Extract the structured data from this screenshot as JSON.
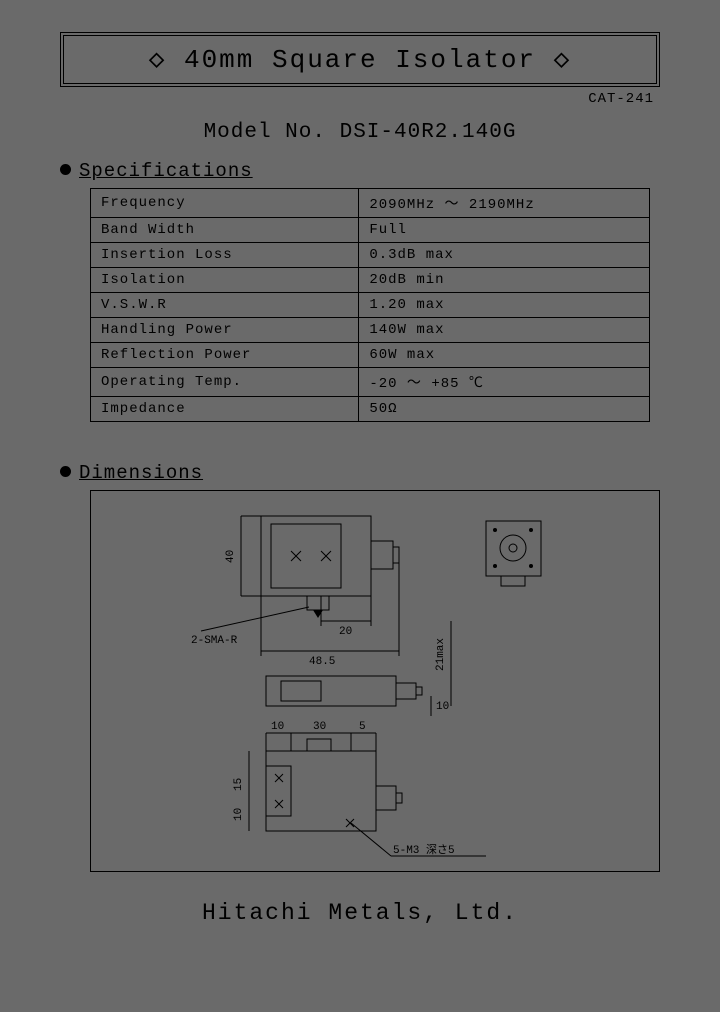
{
  "title": "◇ 40mm Square Isolator ◇",
  "cat": "CAT-241",
  "model_label": "Model No.",
  "model_value": "DSI-40R2.140G",
  "section_spec": "Specifications",
  "section_dim": "Dimensions",
  "spec_rows": [
    {
      "k": "Frequency",
      "v": "2090MHz ～ 2190MHz"
    },
    {
      "k": "Band Width",
      "v": "Full"
    },
    {
      "k": "Insertion Loss",
      "v": "0.3dB max"
    },
    {
      "k": "Isolation",
      "v": "20dB min"
    },
    {
      "k": "V.S.W.R",
      "v": "1.20 max"
    },
    {
      "k": "Handling Power",
      "v": "140W max"
    },
    {
      "k": "Reflection Power",
      "v": "60W max"
    },
    {
      "k": "Operating Temp.",
      "v": "-20 ～ +85 ℃"
    },
    {
      "k": "Impedance",
      "v": "50Ω"
    }
  ],
  "dim_labels": {
    "connector": "2-SMA-R",
    "d40": "40",
    "d20": "20",
    "d485": "48.5",
    "d21max": "21max",
    "d10a": "10",
    "d10b": "10",
    "d30": "30",
    "d5": "5",
    "d1010": "10",
    "d15": "15",
    "hole": "5-M3 深さ5"
  },
  "footer": "Hitachi Metals, Ltd."
}
